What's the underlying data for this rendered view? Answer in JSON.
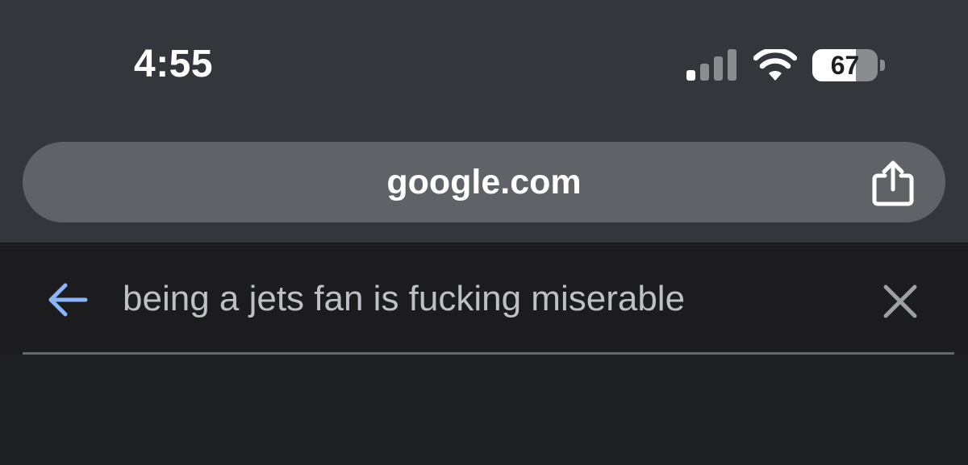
{
  "status_bar": {
    "time": "4:55",
    "signal_bars_active": 1,
    "signal_bars_total": 4,
    "battery_percent": "67",
    "battery_level": 0.67
  },
  "browser": {
    "url": "google.com",
    "share_icon": "share-icon"
  },
  "search": {
    "query": "being a jets fan is fucking miserable",
    "back_icon": "arrow-left-icon",
    "clear_icon": "close-icon"
  },
  "colors": {
    "chrome_bg": "#33363a",
    "url_bar_bg": "#5f6367",
    "search_bg": "#1c1c1e",
    "page_bg": "#202124",
    "back_arrow": "#8ab4f8",
    "query_text": "#bdc1c6"
  }
}
